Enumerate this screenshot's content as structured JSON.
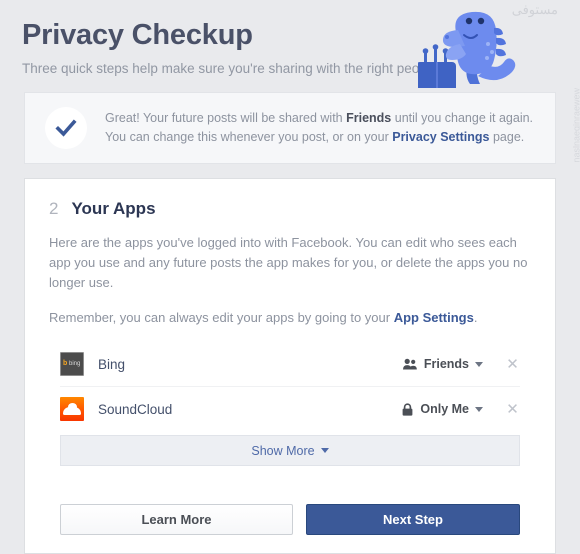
{
  "header": {
    "title": "Privacy Checkup",
    "subtitle": "Three quick steps help make sure you're sharing with the right people",
    "mascot_icon": "dinosaur-mascot",
    "watermark": "naslnaeginraewew"
  },
  "banner": {
    "icon": "checkmark-icon",
    "text_part1": "Great! Your future posts will be shared with ",
    "highlight": "Friends",
    "text_part2": " until you change it again. You can change this whenever you post, or on your ",
    "link": "Privacy Settings",
    "text_part3": " page."
  },
  "section": {
    "number": "2",
    "title": "Your Apps",
    "description": "Here are the apps you've logged into with Facebook. You can edit who sees each app you use and any future posts the app makes for you, or delete the apps you no longer use.",
    "remember_prefix": "Remember, you can always edit your apps by going to your ",
    "remember_link": "App Settings",
    "remember_suffix": "."
  },
  "apps": [
    {
      "name": "Bing",
      "icon": "bing-app-icon",
      "icon_letter": "b",
      "icon_text": "bing",
      "privacy": "Friends",
      "privacy_icon": "friends-icon",
      "remove_icon": "close-icon"
    },
    {
      "name": "SoundCloud",
      "icon": "soundcloud-app-icon",
      "privacy": "Only Me",
      "privacy_icon": "lock-icon",
      "remove_icon": "close-icon"
    }
  ],
  "show_more": {
    "label": "Show More",
    "caret_icon": "chevron-down-icon"
  },
  "footer": {
    "learn_more": "Learn More",
    "next_step": "Next Step"
  },
  "colors": {
    "accent": "#3b5998",
    "page_bg": "#e9eaed",
    "link": "#3b5998",
    "soundcloud_orange": "#ff5500"
  }
}
